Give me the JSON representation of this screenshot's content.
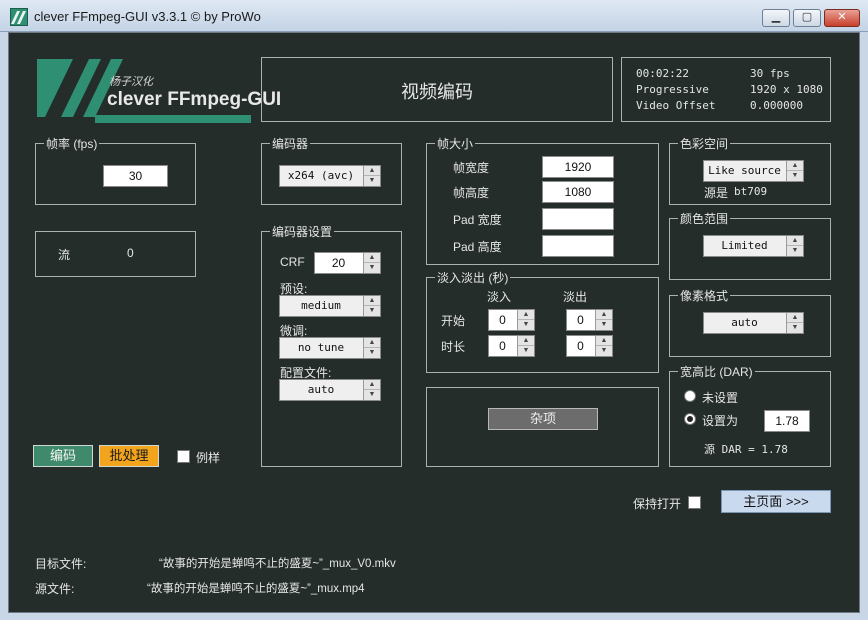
{
  "window": {
    "title": "clever FFmpeg-GUI v3.3.1   © by ProWo",
    "min": "▁",
    "max": "▢",
    "close": "✕"
  },
  "logo": {
    "subtitle": "杨子汉化",
    "name": "clever FFmpeg-GUI"
  },
  "header": {
    "title": "视频编码"
  },
  "info": {
    "duration": "00:02:22",
    "fps": "30 fps",
    "scan": "Progressive",
    "resolution": "1920 x 1080",
    "offset_label": "Video Offset",
    "offset_value": "0.000000"
  },
  "framerate": {
    "legend": "帧率 (fps)",
    "value": "30"
  },
  "stream": {
    "label": "流",
    "value": "0"
  },
  "codec": {
    "legend": "编码器",
    "value": "x264 (avc)"
  },
  "codec_settings": {
    "legend": "编码器设置",
    "crf_label": "CRF",
    "crf_value": "20",
    "preset_label": "预设:",
    "preset_value": "medium",
    "tune_label": "微调:",
    "tune_value": "no tune",
    "profile_label": "配置文件:",
    "profile_value": "auto"
  },
  "frame_size": {
    "legend": "帧大小",
    "width_label": "帧宽度",
    "width_value": "1920",
    "height_label": "帧高度",
    "height_value": "1080",
    "pad_width_label": "Pad 宽度",
    "pad_width_value": "",
    "pad_height_label": "Pad 高度",
    "pad_height_value": ""
  },
  "fade": {
    "legend": "淡入淡出 (秒)",
    "in_label": "淡入",
    "out_label": "淡出",
    "start_label": "开始",
    "duration_label": "时长",
    "start_in": "0",
    "start_out": "0",
    "dur_in": "0",
    "dur_out": "0"
  },
  "misc_button": "杂项",
  "color_space": {
    "legend": "色彩空间",
    "value": "Like source",
    "source_label": "源是",
    "source_value": "bt709"
  },
  "color_range": {
    "legend": "颜色范围",
    "value": "Limited"
  },
  "pixel_format": {
    "legend": "像素格式",
    "value": "auto"
  },
  "aspect": {
    "legend": "宽高比 (DAR)",
    "unset_label": "未设置",
    "set_label": "设置为",
    "set_value": "1.78",
    "source_dar": "源 DAR = 1.78"
  },
  "actions": {
    "encode": "编码",
    "batch": "批处理",
    "sample": "例样",
    "keep_open": "保持打开",
    "main_page": "主页面 >>>"
  },
  "files": {
    "target_label": "目标文件:",
    "target_value": "“故事的开始是蝉鸣不止的盛夏~”_mux_V0.mkv",
    "source_label": "源文件:",
    "source_value": "“故事的开始是蝉鸣不止的盛夏~”_mux.mp4"
  },
  "colors": {
    "client_bg": "#242d2a",
    "logo_green": "#2f8f73",
    "encode_button": "#3f8a6c",
    "batch_button": "#f2a51c",
    "main_button": "#c9d9ee"
  }
}
